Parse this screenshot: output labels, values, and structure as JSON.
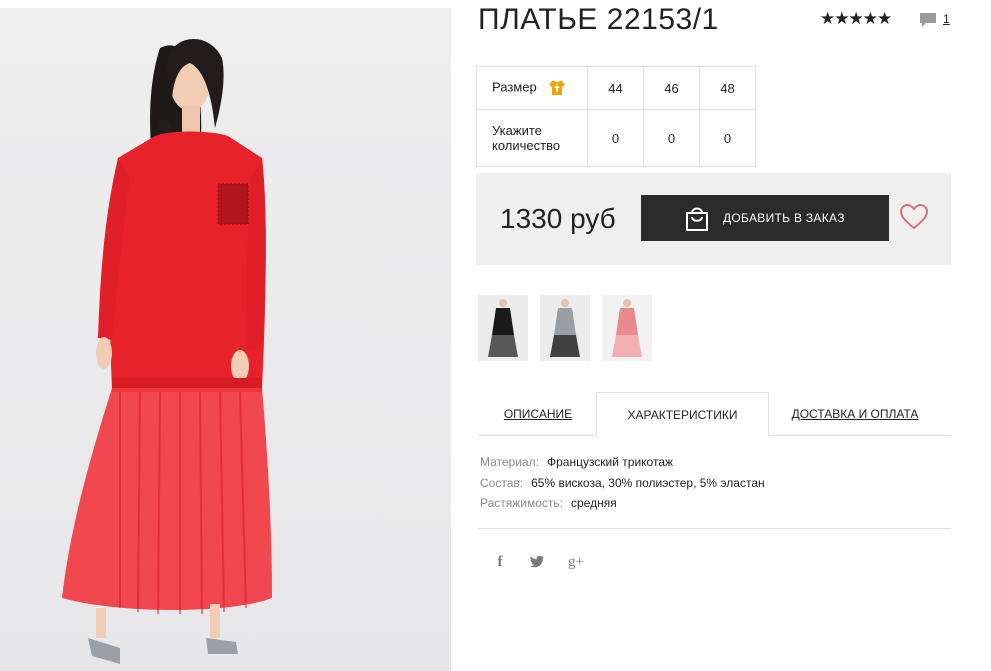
{
  "product": {
    "title": "ПЛАТЬЕ 22153/1",
    "rating_stars": "★★★★★",
    "comments_count": "1"
  },
  "sizes": {
    "size_label": "Размер",
    "quantity_label": "Укажите количество",
    "values": [
      "44",
      "46",
      "48"
    ],
    "quantities": [
      "0",
      "0",
      "0"
    ]
  },
  "order": {
    "price": "1330 руб",
    "add_button_label": "ДОБАВИТЬ В ЗАКАЗ"
  },
  "thumbnails": [
    {
      "color": "black"
    },
    {
      "color": "grey"
    },
    {
      "color": "pink"
    }
  ],
  "tabs": [
    {
      "label": "ОПИСАНИЕ"
    },
    {
      "label": "ХАРАКТЕРИСТИКИ",
      "active": true
    },
    {
      "label": "ДОСТАВКА И ОПЛАТА"
    }
  ],
  "specs": [
    {
      "key": "Материал:",
      "value": "Французский трикотаж"
    },
    {
      "key": "Состав:",
      "value": "65% вискоза, 30% полиэстер, 5% эластан"
    },
    {
      "key": "Растяжимость:",
      "value": "средняя"
    }
  ],
  "social": [
    {
      "icon": "facebook-icon",
      "glyph": "f"
    },
    {
      "icon": "twitter-icon"
    },
    {
      "icon": "google-plus-icon",
      "glyph": "g+"
    }
  ],
  "colors": {
    "dress_red": "#e8222a",
    "button_dark": "#2b2b2b",
    "heart_pink": "#d9707e",
    "size_icon_orange": "#f0a500"
  }
}
